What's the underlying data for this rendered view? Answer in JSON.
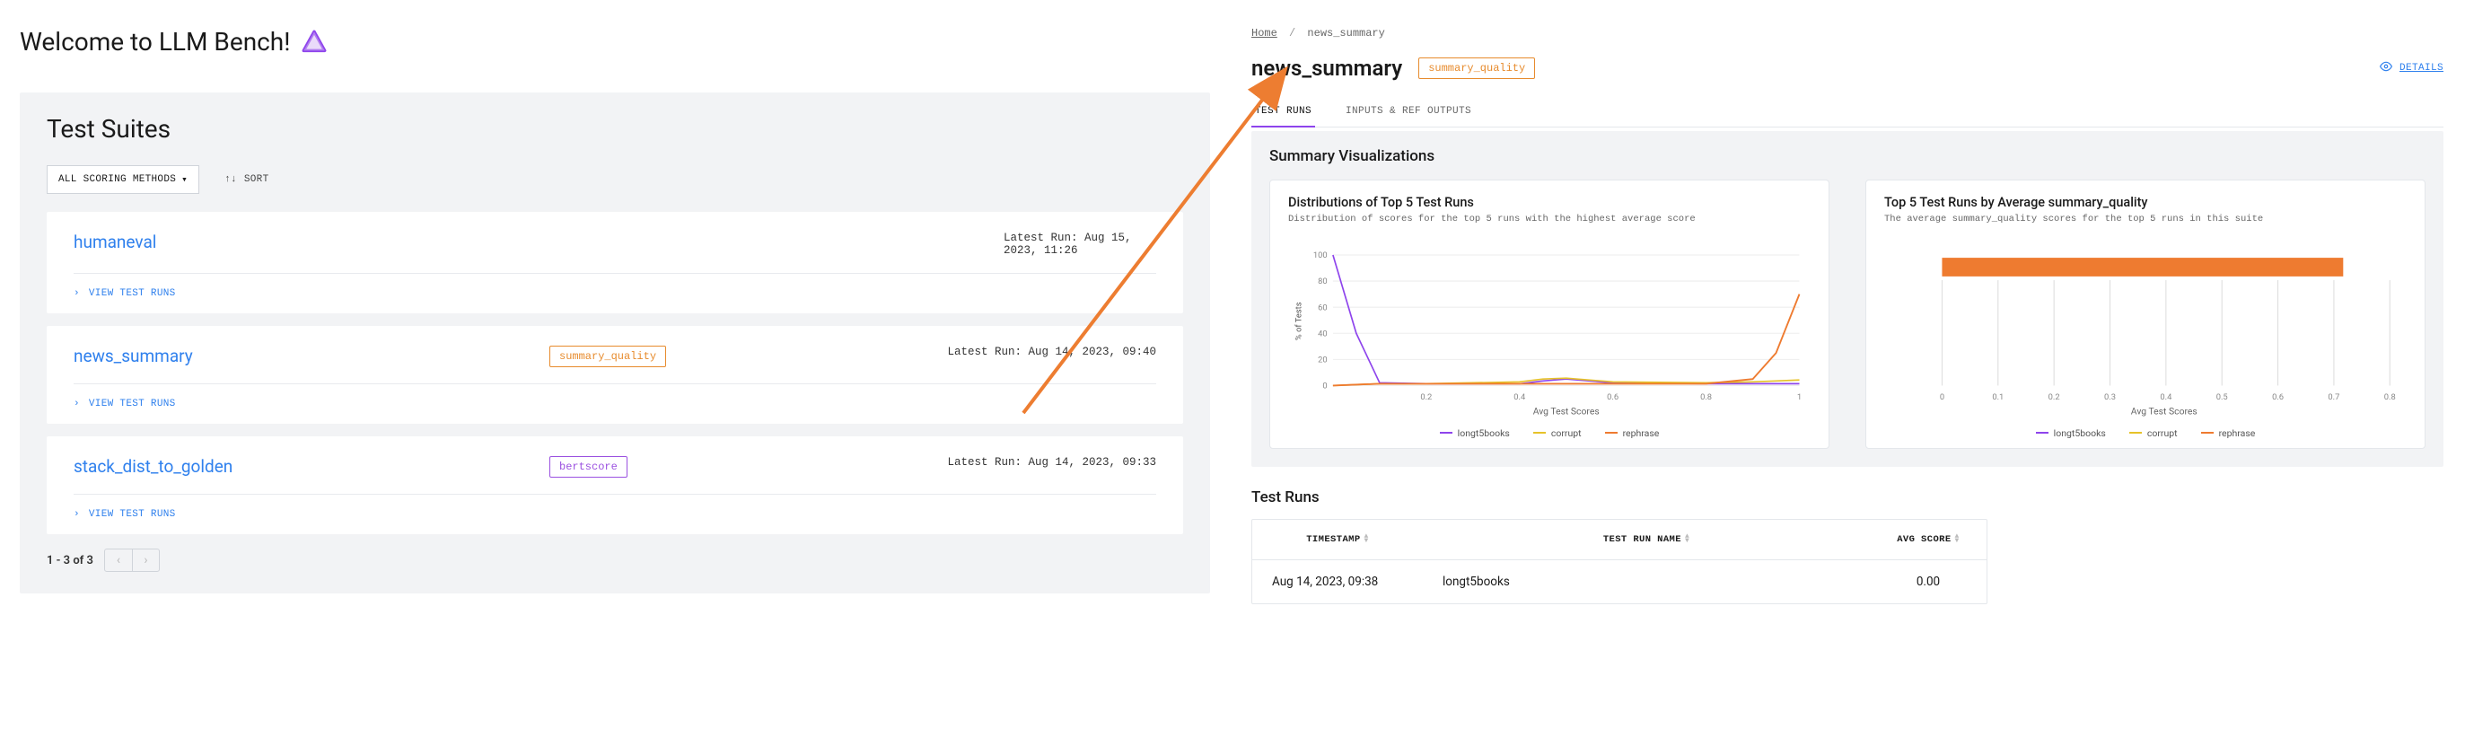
{
  "left": {
    "welcome": "Welcome to LLM Bench!",
    "suites_title": "Test Suites",
    "dropdown_label": "ALL SCORING METHODS",
    "sort_label": "SORT",
    "pagination": "1 - 3 of 3",
    "view_runs_label": "VIEW TEST RUNS",
    "suites": [
      {
        "name": "humaneval",
        "tag": "",
        "tag_class": "",
        "latest": "Latest Run: Aug 15, 2023, 11:26"
      },
      {
        "name": "news_summary",
        "tag": "summary_quality",
        "tag_class": "tag-orange",
        "latest": "Latest Run: Aug 14, 2023, 09:40"
      },
      {
        "name": "stack_dist_to_golden",
        "tag": "bertscore",
        "tag_class": "tag-purple",
        "latest": "Latest Run: Aug 14, 2023, 09:33"
      }
    ]
  },
  "right": {
    "crumb_home": "Home",
    "crumb_current": "news_summary",
    "title": "news_summary",
    "tag": "summary_quality",
    "details_link": "DETAILS",
    "tabs": {
      "runs": "TEST RUNS",
      "inputs": "INPUTS & REF OUTPUTS"
    },
    "viz_heading": "Summary Visualizations",
    "chart1": {
      "title": "Distributions of Top 5 Test Runs",
      "sub": "Distribution of scores for the top 5 runs with the highest average score",
      "xlabel": "Avg Test Scores",
      "ylabel": "% of Tests"
    },
    "chart2": {
      "title": "Top 5 Test Runs by Average summary_quality",
      "sub": "The average summary_quality scores for the top 5 runs in this suite",
      "xlabel": "Avg Test Scores"
    },
    "legend": {
      "a": "longt5books",
      "b": "corrupt",
      "c": "rephrase"
    },
    "table": {
      "head_ts": "TIMESTAMP",
      "head_name": "TEST RUN NAME",
      "head_score": "AVG SCORE",
      "rows": [
        {
          "ts": "Aug 14, 2023, 09:38",
          "name": "longt5books",
          "score": "0.00"
        }
      ]
    },
    "runs_heading": "Test Runs"
  },
  "chart_data": [
    {
      "type": "line",
      "title": "Distributions of Top 5 Test Runs",
      "xlabel": "Avg Test Scores",
      "ylabel": "% of Tests",
      "x": [
        0,
        0.05,
        0.1,
        0.2,
        0.3,
        0.4,
        0.45,
        0.5,
        0.6,
        0.7,
        0.8,
        0.9,
        0.95,
        1.0
      ],
      "series": [
        {
          "name": "longt5books",
          "color": "#8e44ec",
          "values": [
            100,
            40,
            2,
            1,
            1,
            2,
            4,
            3,
            2,
            1,
            1,
            1,
            1,
            1
          ]
        },
        {
          "name": "corrupt",
          "color": "#e6c229",
          "values": [
            0,
            0,
            1,
            1,
            2,
            3,
            5,
            4,
            2,
            1,
            1,
            2,
            3,
            4
          ]
        },
        {
          "name": "rephrase",
          "color": "#ee7b30",
          "values": [
            0,
            1,
            1,
            1,
            1,
            1,
            1,
            1,
            1,
            1,
            1,
            4,
            25,
            70
          ]
        }
      ],
      "xlim": [
        0,
        1
      ],
      "ylim": [
        0,
        100
      ],
      "xticks": [
        0.2,
        0.4,
        0.6,
        0.8,
        1
      ],
      "yticks": [
        0,
        20,
        40,
        60,
        80,
        100
      ]
    },
    {
      "type": "bar",
      "orientation": "horizontal",
      "title": "Top 5 Test Runs by Average summary_quality",
      "xlabel": "Avg Test Scores",
      "categories": [
        "rephrase"
      ],
      "series": [
        {
          "name": "rephrase",
          "color": "#ee7b30",
          "values": [
            0.72
          ]
        }
      ],
      "xlim": [
        0,
        0.8
      ],
      "xticks": [
        0,
        0.1,
        0.2,
        0.3,
        0.4,
        0.5,
        0.6,
        0.7,
        0.8
      ]
    }
  ]
}
